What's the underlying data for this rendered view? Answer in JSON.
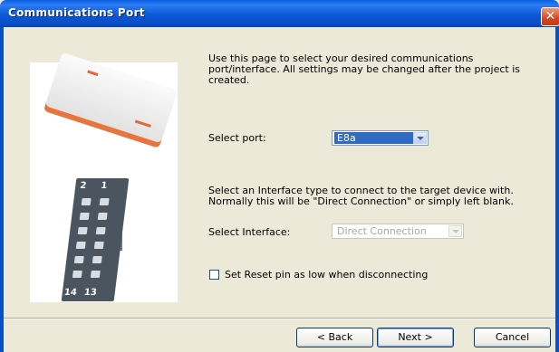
{
  "window": {
    "title": "Communications Port",
    "close_glyph": "✕"
  },
  "intro_text": "Use this page to select your desired communications port/interface. All settings may be changed after the project is created.",
  "port": {
    "label": "Select port:",
    "selected": "E8a"
  },
  "interface_text": "Select an Interface type to connect to the target device with. Normally this will be \"Direct Connection\" or simply left blank.",
  "interface": {
    "label": "Select Interface:",
    "selected": "Direct Connection"
  },
  "reset_checkbox": {
    "label": "Set Reset pin as low when disconnecting",
    "checked": false
  },
  "image": {
    "pin_top_left": "2",
    "pin_top_right": "1",
    "pin_bottom_left": "14",
    "pin_bottom_right": "13"
  },
  "buttons": {
    "back": "< Back",
    "next": "Next >",
    "cancel": "Cancel"
  },
  "colors": {
    "title_bar": "#0a4fc6",
    "selection": "#316ac5",
    "device_accent": "#e8753e"
  }
}
